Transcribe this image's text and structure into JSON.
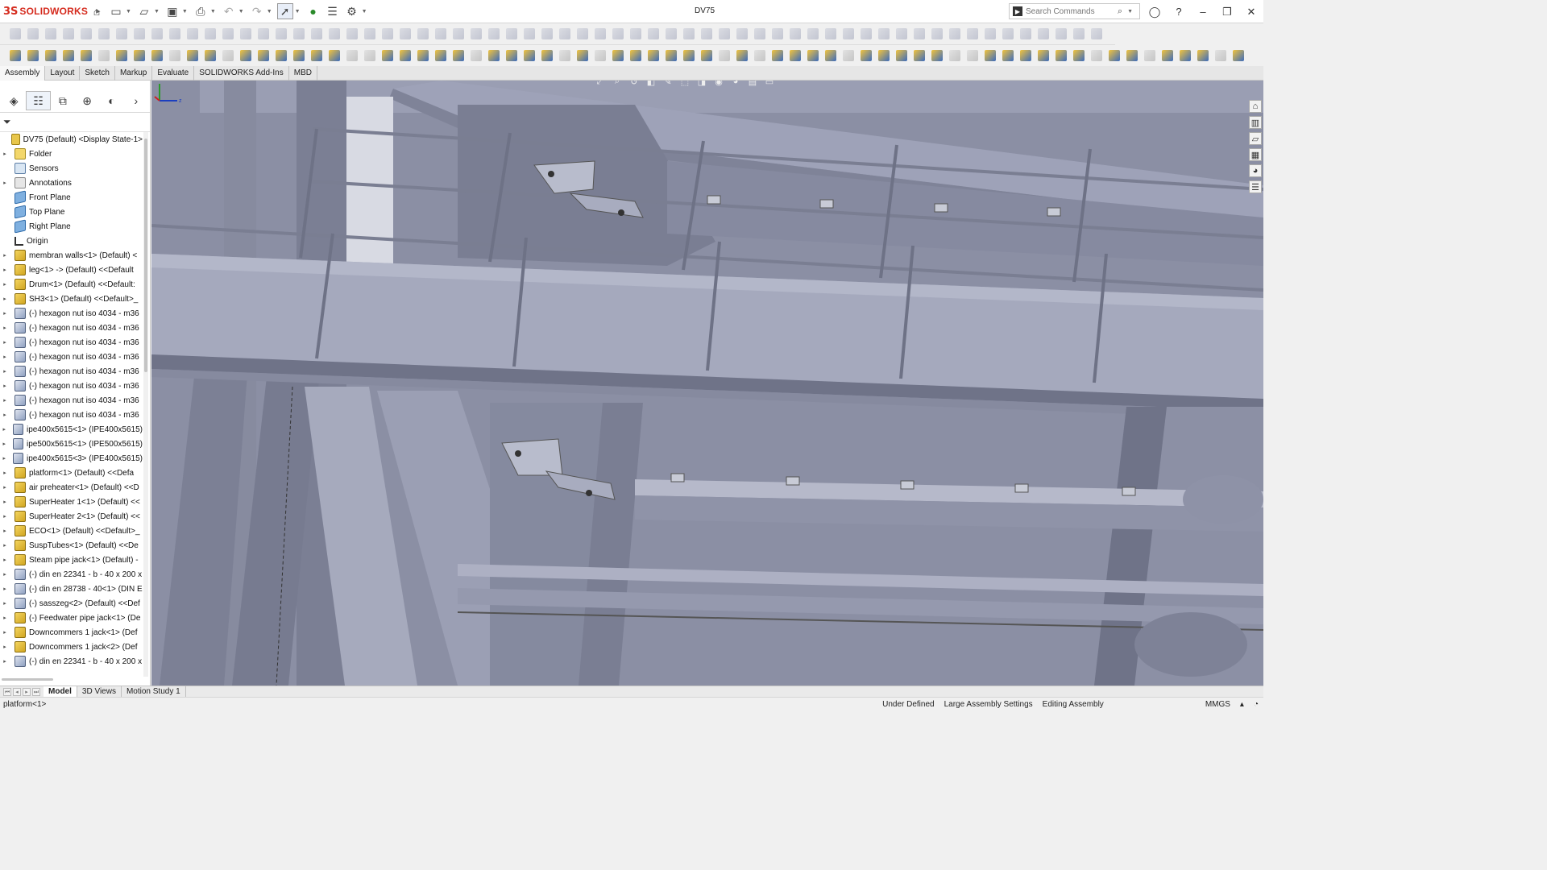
{
  "app": {
    "logo_ds": "3S",
    "logo_text": "SOLIDWORKS",
    "title": "DV75",
    "search_placeholder": "Search Commands"
  },
  "tabs": [
    "Assembly",
    "Layout",
    "Sketch",
    "Markup",
    "Evaluate",
    "SOLIDWORKS Add-Ins",
    "MBD"
  ],
  "active_tab": "Assembly",
  "tree": [
    {
      "label": "DV75 (Default) <Display State-1>",
      "icon": "root",
      "arrow": ""
    },
    {
      "label": "Folder",
      "icon": "folder",
      "arrow": "▸"
    },
    {
      "label": "Sensors",
      "icon": "sensor",
      "arrow": ""
    },
    {
      "label": "Annotations",
      "icon": "annot",
      "arrow": "▸"
    },
    {
      "label": "Front Plane",
      "icon": "plane",
      "arrow": ""
    },
    {
      "label": "Top Plane",
      "icon": "plane",
      "arrow": ""
    },
    {
      "label": "Right Plane",
      "icon": "plane",
      "arrow": ""
    },
    {
      "label": "Origin",
      "icon": "origin",
      "arrow": ""
    },
    {
      "label": "membran walls<1> (Default) <",
      "icon": "asm",
      "arrow": "▸"
    },
    {
      "label": "leg<1> -> (Default) <<Default",
      "icon": "asm",
      "arrow": "▸"
    },
    {
      "label": "Drum<1> (Default) <<Default:",
      "icon": "asm",
      "arrow": "▸"
    },
    {
      "label": "SH3<1> (Default) <<Default>_",
      "icon": "asm",
      "arrow": "▸"
    },
    {
      "label": "(-) hexagon nut iso 4034 - m36",
      "icon": "part",
      "arrow": "▸"
    },
    {
      "label": "(-) hexagon nut iso 4034 - m36",
      "icon": "part",
      "arrow": "▸"
    },
    {
      "label": "(-) hexagon nut iso 4034 - m36",
      "icon": "part",
      "arrow": "▸"
    },
    {
      "label": "(-) hexagon nut iso 4034 - m36",
      "icon": "part",
      "arrow": "▸"
    },
    {
      "label": "(-) hexagon nut iso 4034 - m36",
      "icon": "part",
      "arrow": "▸"
    },
    {
      "label": "(-) hexagon nut iso 4034 - m36",
      "icon": "part",
      "arrow": "▸"
    },
    {
      "label": "(-) hexagon nut iso 4034 - m36",
      "icon": "part",
      "arrow": "▸"
    },
    {
      "label": "(-) hexagon nut iso 4034 - m36",
      "icon": "part",
      "arrow": "▸"
    },
    {
      "label": "ipe400x5615<1> (IPE400x5615)",
      "icon": "part",
      "arrow": "▸"
    },
    {
      "label": "ipe500x5615<1> (IPE500x5615)",
      "icon": "part",
      "arrow": "▸"
    },
    {
      "label": "ipe400x5615<3> (IPE400x5615)",
      "icon": "part",
      "arrow": "▸"
    },
    {
      "label": "platform<1> (Default) <<Defa",
      "icon": "asm",
      "arrow": "▸"
    },
    {
      "label": "air preheater<1> (Default) <<D",
      "icon": "asm",
      "arrow": "▸"
    },
    {
      "label": "SuperHeater 1<1> (Default) <<",
      "icon": "asm",
      "arrow": "▸"
    },
    {
      "label": "SuperHeater 2<1> (Default) <<",
      "icon": "asm",
      "arrow": "▸"
    },
    {
      "label": "ECO<1> (Default) <<Default>_",
      "icon": "asm",
      "arrow": "▸"
    },
    {
      "label": "SuspTubes<1> (Default) <<De",
      "icon": "asm",
      "arrow": "▸"
    },
    {
      "label": "Steam pipe jack<1> (Default) -",
      "icon": "asm",
      "arrow": "▸"
    },
    {
      "label": "(-) din en 22341 - b - 40 x 200 x",
      "icon": "part",
      "arrow": "▸"
    },
    {
      "label": "(-) din en 28738 - 40<1> (DIN E",
      "icon": "part",
      "arrow": "▸"
    },
    {
      "label": "(-) sasszeg<2> (Default) <<Def",
      "icon": "part",
      "arrow": "▸"
    },
    {
      "label": "(-) Feedwater pipe jack<1> (De",
      "icon": "asm",
      "arrow": "▸"
    },
    {
      "label": "Downcommers 1 jack<1> (Def",
      "icon": "asm",
      "arrow": "▸"
    },
    {
      "label": "Downcommers 1 jack<2> (Def",
      "icon": "asm",
      "arrow": "▸"
    },
    {
      "label": "(-) din en 22341 - b - 40 x 200 x",
      "icon": "part",
      "arrow": "▸"
    }
  ],
  "bottom_tabs": [
    "Model",
    "3D Views",
    "Motion Study 1"
  ],
  "active_bottom_tab": "Model",
  "status": {
    "left": "platform<1>",
    "under_defined": "Under Defined",
    "large_assembly": "Large Assembly Settings",
    "editing": "Editing Assembly",
    "units": "MMGS"
  },
  "colors": {
    "viewport_bg": "#8b8fa4",
    "steel_light": "#a9adc1",
    "steel_mid": "#9296ab",
    "steel_dark": "#6e7286",
    "accent_red": "#d52b1e"
  }
}
